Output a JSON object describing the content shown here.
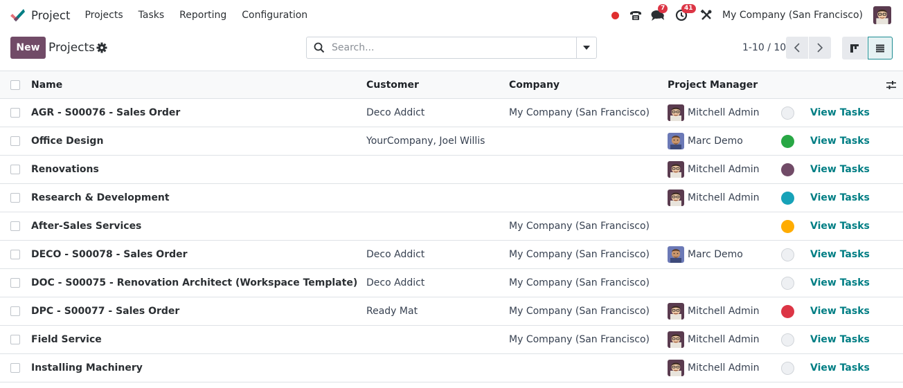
{
  "app": {
    "name": "Project",
    "menu": [
      "Projects",
      "Tasks",
      "Reporting",
      "Configuration"
    ],
    "logo_colors": [
      "#017e84",
      "#714b67",
      "#e46f78"
    ]
  },
  "systray": {
    "recording_color": "#e02f2f",
    "messages_count": "7",
    "activities_count": "41",
    "company": "My Company (San Francisco)",
    "user_avatar": "mitchell-admin-avatar"
  },
  "control_panel": {
    "new_label": "New",
    "title": "Projects",
    "search_placeholder": "Search...",
    "pager": "1-10 / 10"
  },
  "colors": {
    "accent": "#714b67",
    "link": "#017e84"
  },
  "table": {
    "columns": [
      "Name",
      "Customer",
      "Company",
      "Project Manager"
    ],
    "rows": [
      {
        "name": "AGR - S00076 - Sales Order",
        "customer": "Deco Addict",
        "company": "My Company (San Francisco)",
        "manager": "Mitchell Admin",
        "avatar": "mitchell",
        "color": "",
        "action": "View Tasks"
      },
      {
        "name": "Office Design",
        "customer": "YourCompany, Joel Willis",
        "company": "",
        "manager": "Marc Demo",
        "avatar": "marc",
        "color": "#28a745",
        "action": "View Tasks"
      },
      {
        "name": "Renovations",
        "customer": "",
        "company": "",
        "manager": "Mitchell Admin",
        "avatar": "mitchell",
        "color": "#714b67",
        "action": "View Tasks"
      },
      {
        "name": "Research & Development",
        "customer": "",
        "company": "",
        "manager": "Mitchell Admin",
        "avatar": "mitchell",
        "color": "#17a2b8",
        "action": "View Tasks"
      },
      {
        "name": "After-Sales Services",
        "customer": "",
        "company": "My Company (San Francisco)",
        "manager": "",
        "avatar": "",
        "color": "#ffac00",
        "action": "View Tasks"
      },
      {
        "name": "DECO - S00078 - Sales Order",
        "customer": "Deco Addict",
        "company": "My Company (San Francisco)",
        "manager": "Marc Demo",
        "avatar": "marc",
        "color": "",
        "action": "View Tasks"
      },
      {
        "name": "DOC - S00075 - Renovation Architect (Workspace Template)",
        "customer": "Deco Addict",
        "company": "My Company (San Francisco)",
        "manager": "",
        "avatar": "",
        "color": "",
        "action": "View Tasks"
      },
      {
        "name": "DPC - S00077 - Sales Order",
        "customer": "Ready Mat",
        "company": "My Company (San Francisco)",
        "manager": "Mitchell Admin",
        "avatar": "mitchell",
        "color": "#dc3545",
        "action": "View Tasks"
      },
      {
        "name": "Field Service",
        "customer": "",
        "company": "My Company (San Francisco)",
        "manager": "Mitchell Admin",
        "avatar": "mitchell",
        "color": "",
        "action": "View Tasks"
      },
      {
        "name": "Installing Machinery",
        "customer": "",
        "company": "",
        "manager": "Mitchell Admin",
        "avatar": "mitchell",
        "color": "",
        "action": "View Tasks"
      }
    ]
  }
}
